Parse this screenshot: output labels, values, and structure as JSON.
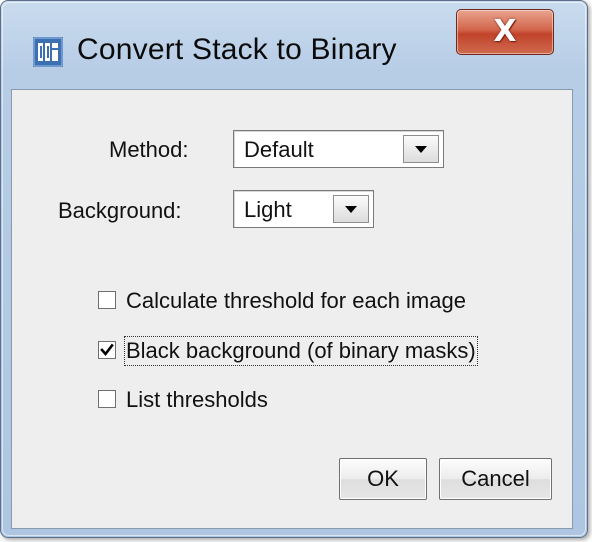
{
  "window": {
    "title": "Convert Stack to Binary",
    "close_symbol": "X",
    "icon": "imagej-app-icon"
  },
  "form": {
    "method": {
      "label": "Method:",
      "value": "Default"
    },
    "background": {
      "label": "Background:",
      "value": "Light"
    },
    "options": [
      {
        "label": "Calculate threshold for each image",
        "checked": false
      },
      {
        "label": "Black background (of binary masks)",
        "checked": true
      },
      {
        "label": "List thresholds",
        "checked": false
      }
    ]
  },
  "buttons": {
    "ok": "OK",
    "cancel": "Cancel"
  },
  "colors": {
    "title_bar": "#b7cde6",
    "close_button": "#c7452c",
    "dialog_body": "#eeeeee"
  }
}
